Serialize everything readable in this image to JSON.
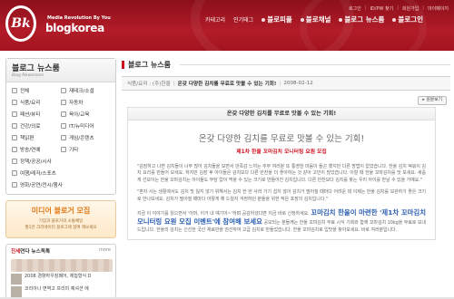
{
  "header": {
    "logo_tagline": "Media Revolution By You",
    "logo_name": "blogkorea",
    "top_links": [
      "로그인",
      "ID/PW 찾기",
      "회원가입",
      "마이페이지"
    ],
    "nav": [
      {
        "label": "카테고리",
        "big": false
      },
      {
        "label": "인기태그",
        "big": false
      },
      {
        "label": "블로피플",
        "big": true
      },
      {
        "label": "블로채널",
        "big": true
      },
      {
        "label": "블로그 뉴스룸",
        "big": true
      },
      {
        "label": "블로그인",
        "big": true
      }
    ]
  },
  "sidebar": {
    "newsroom_title": "블로그 뉴스룸",
    "newsroom_sub": "Blog Newsroom",
    "categories": [
      {
        "label": "전체",
        "full": false
      },
      {
        "label": "재테크/소셜",
        "full": false
      },
      {
        "label": "식품/요리",
        "full": false
      },
      {
        "label": "자동차",
        "full": false
      },
      {
        "label": "패션/뷰티",
        "full": false
      },
      {
        "label": "육아/교육",
        "full": false
      },
      {
        "label": "건강/의료",
        "full": false
      },
      {
        "label": "IT/뉴미디어",
        "full": false
      },
      {
        "label": "책읽편",
        "full": false
      },
      {
        "label": "게임/콘텐츠",
        "full": false
      },
      {
        "label": "방송/연예",
        "full": false
      },
      {
        "label": "기타",
        "full": false
      },
      {
        "label": "정책/공공/시사",
        "full": true
      },
      {
        "label": "여행/레저/스포츠",
        "full": true
      },
      {
        "label": "영화/공연/전시/행사",
        "full": true
      }
    ],
    "recruit": {
      "title": "미디어 블로거 모집",
      "line1": "기업과 블로거의 소통채널",
      "line2": "월1만 크리에이터 블로그에 참여 해보세요"
    },
    "wishlist": {
      "title_red": "진세",
      "title_rest": "연다 뉴스독톡",
      "more": "more",
      "items": [
        "2008 경향하우징페어, 체험형식 D",
        "코리아나 면역고 프리미 예셔션 에"
      ]
    }
  },
  "main": {
    "section_title": "블로그 뉴스룸",
    "article_category": "식품/요리 : (주)한울",
    "article_headline": "온갖 다양한 김치를 무료로 맛볼 수 있는 기회!",
    "article_date": "2008-02-12",
    "view_original": "원문보기",
    "box_title": "온갖 다양한 김치를 무료로 맛볼 수 있는 기회!",
    "big_title": "온갖 다양한 김치를 무료로 맛볼 수 있는 기회!",
    "sub_title": "제1차 한울 꼬마김치 모니터링 요원 모집",
    "para1": "\"김장하고 나면 김치들이 너무 많아 김치들을 보면서 만족감 느끼는 주부 여러분 또 통영한 마음이 들곤 했지만 다른 방법이 없었습니다. 한울 김치 떡볶이 김치 요리를 만들어 보세요. 하지만 김장 후 아이들은 김치보다 다른 반찬을 더 좋아하는 것 같아 고민이 많았습니다. 이럴 때 한울 꼬마김치를 맛 보세요. 새롭게 선보이는 한울 꼬마김치는 아이들도 부담 없이 먹을 수 있는 크기로 만들어진 김치입니다. 다른 반찬보다 김치를 찾는 우리 아이를 만날 수 있을 거예요.\"",
    "para2": "\"혼자 사는 생활에서도 김치 맛 잃지 않기 위해서는 김치 한 번 사러 가기 쉽지 않아 김치가 떨어질 때마다 어려운 데 이제는 한울 김치를 보관하기 좋은 크기로 만나보세요. 김치가 떨어질 때마다 어떻게 해 드릴지 걱정하던 분들을 위한 작은 포장의 김치입니다.\"",
    "para3_pre": "지금 이 이야기를 읽으면서 '어머, 이거 내 얘기야~'하며 공감하셨다면 지금 바로 신청하세요.",
    "para3_highlight": "꼬마김치 한울이 마련한 '제1차 꼬마김치 모니터링 요원 모집 이벤트'에 참여해 보세요",
    "para3_post": " 공모되는 분들께는 한울 꼬마김치 무료 시식 기회와 함께 꼬마김치 10kg을 무료로 보내드립니다. 한울의 김치는 신선한 국산 재료만을 엄선하여 고급 김치로 만들었습니다. 한울 꼬마김치로 입맛을 찾아보세요. 바로 여러분입니다."
  }
}
